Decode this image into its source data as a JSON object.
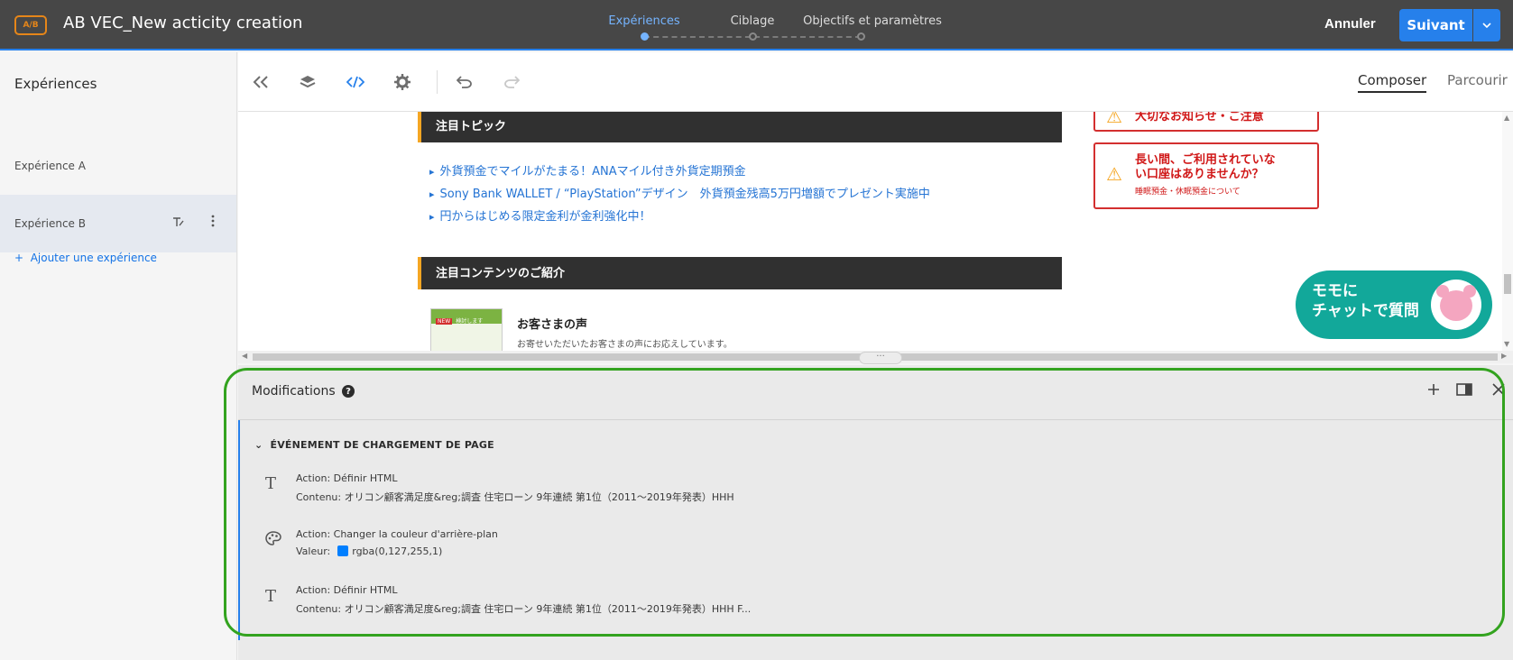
{
  "header": {
    "ab_badge": "A/B",
    "title": "AB VEC_New acticity creation",
    "steps": [
      {
        "label": "Expériences",
        "active": true
      },
      {
        "label": "Ciblage",
        "active": false
      },
      {
        "label": "Objectifs et paramètres",
        "active": false
      }
    ],
    "cancel_label": "Annuler",
    "next_label": "Suivant"
  },
  "sidebar": {
    "title": "Expériences",
    "experiences": [
      {
        "label": "Expérience A",
        "selected": false
      },
      {
        "label": "Expérience B",
        "selected": true
      }
    ],
    "add_label": "Ajouter une expérience"
  },
  "toolbar": {
    "icons": [
      "collapse-icon",
      "layers-icon",
      "code-icon",
      "settings-icon",
      "undo-icon",
      "redo-icon"
    ],
    "modes": [
      {
        "label": "Composer",
        "active": true
      },
      {
        "label": "Parcourir",
        "active": false
      }
    ]
  },
  "preview": {
    "section1_title": "注目トピック",
    "links": [
      "外貨預金でマイルがたまる！ANAマイル付き外貨定期預金",
      "Sony Bank WALLET / “PlayStation”デザイン　外貨預金残高5万円増額でプレゼント実施中",
      "円からはじめる限定金利が金利強化中！"
    ],
    "section2_title": "注目コンテンツのご紹介",
    "warning_top": "大切なお知らせ・ご注意",
    "warning_main_1": "長い間、ご利用されていな",
    "warning_main_2": "い口座はありませんか？",
    "warning_sub": "睡眠預金・休眠預金について",
    "chat_line1": "モモに",
    "chat_line2": "チャットで質問",
    "thumb_badge": "NEW",
    "thumb_text": "検討します",
    "voice_title": "お客さまの声",
    "voice_sub": "お寄せいただいたお客さまの声にお応えしています。"
  },
  "modifications": {
    "title": "Modifications",
    "help": "?",
    "group_title": "ÉVÉNEMENT DE CHARGEMENT DE PAGE",
    "actions": [
      {
        "icon": "text-icon",
        "action": "Action: Définir HTML",
        "detail_label": "Contenu:",
        "detail": "オリコン顧客満足度&reg;調査 住宅ローン 9年連続 第1位（2011～2019年発表）HHH"
      },
      {
        "icon": "palette-icon",
        "action": "Action: Changer la couleur d'arrière-plan",
        "detail_label": "Valeur:",
        "detail": "rgba(0,127,255,1)",
        "swatch_color": "#007fff"
      },
      {
        "icon": "text-icon",
        "action": "Action: Définir HTML",
        "detail_label": "Contenu:",
        "detail": "オリコン顧客満足度&reg;調査 住宅ローン 9年連続 第1位（2011～2019年発表）HHH F..."
      }
    ]
  },
  "colors": {
    "header_bg": "#474747",
    "accent_blue": "#2680eb",
    "highlight_green": "#33a31f",
    "warning_red": "#d01717"
  }
}
